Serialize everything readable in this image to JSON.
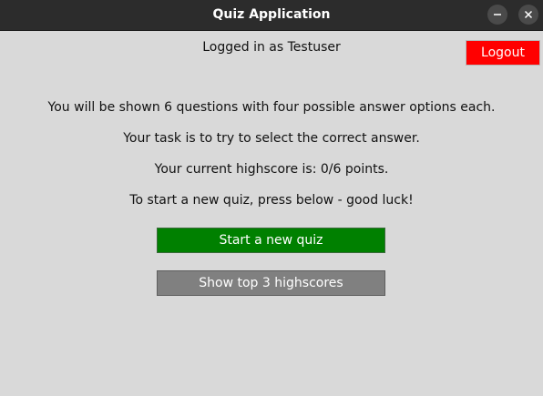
{
  "window": {
    "title": "Quiz Application",
    "minimize_icon": "minimize-icon",
    "close_icon": "close-icon"
  },
  "header": {
    "logged_in_text": "Logged in as Testuser",
    "logout_label": "Logout"
  },
  "intro": {
    "line1": "You will be shown 6 questions with four possible answer options each.",
    "line2": "Your task is to try to select the correct answer.",
    "line3": "Your current highscore is: 0/6 points.",
    "line4": "To start a new quiz, press below - good luck!"
  },
  "actions": {
    "start_label": "Start a new quiz",
    "highscores_label": "Show top 3 highscores"
  },
  "colors": {
    "logout_bg": "#ff0000",
    "start_bg": "#008000",
    "highscores_bg": "#808080",
    "background": "#d9d9d9",
    "titlebar": "#2c2c2c"
  }
}
